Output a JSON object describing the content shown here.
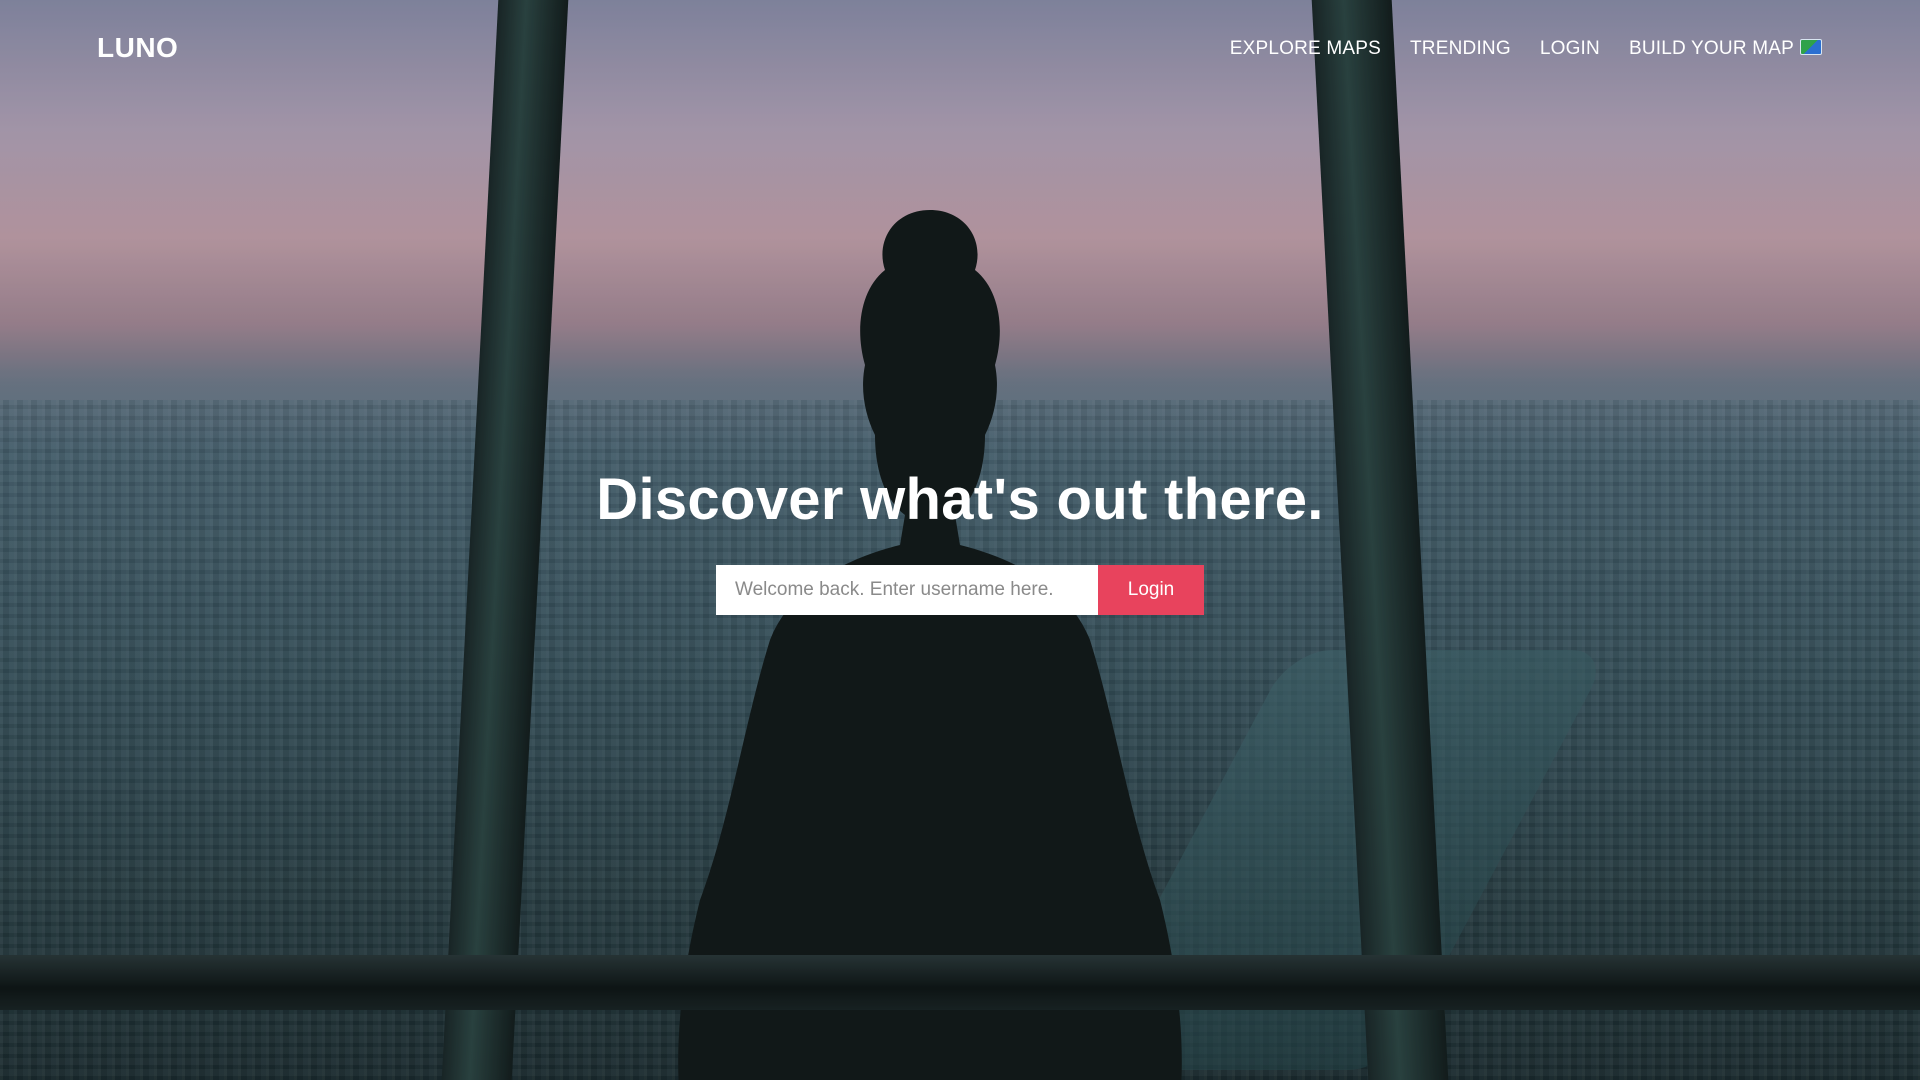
{
  "brand": {
    "name": "LUNO"
  },
  "nav": {
    "items": [
      {
        "label": "EXPLORE MAPS"
      },
      {
        "label": "TRENDING"
      },
      {
        "label": "LOGIN"
      },
      {
        "label": "BUILD YOUR MAP",
        "icon": "map-flag-icon"
      }
    ]
  },
  "hero": {
    "headline": "Discover what's out there.",
    "username_placeholder": "Welcome back. Enter username here.",
    "username_value": "",
    "login_button_label": "Login",
    "background": "photo-woman-overlooking-city-at-dusk"
  },
  "colors": {
    "accent": "#e8435d",
    "text": "#ffffff"
  }
}
